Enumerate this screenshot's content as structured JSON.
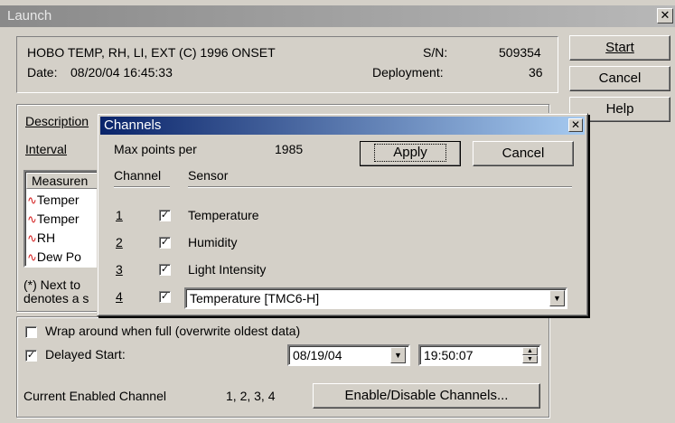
{
  "window": {
    "title": "Launch"
  },
  "info": {
    "device": "HOBO TEMP, RH, LI, EXT (C) 1996 ONSET",
    "date_label": "Date:",
    "date_value": "08/20/04  16:45:33",
    "sn_label": "S/N:",
    "sn_value": "509354",
    "deployment_label": "Deployment:",
    "deployment_value": "36"
  },
  "buttons": {
    "start": "Start",
    "cancel": "Cancel",
    "help": "Help"
  },
  "description": {
    "label": "Description",
    "interval_label": "Interval",
    "measurements_header": "Measuren",
    "measurements": [
      "Temper",
      "Temper",
      "RH",
      "Dew Po"
    ],
    "note_line1": "(*) Next to",
    "note_line2": "denotes a s"
  },
  "channels_dialog": {
    "title": "Channels",
    "max_points_label": "Max points per",
    "max_points_value": "1985",
    "apply_label": "Apply",
    "cancel_label": "Cancel",
    "channel_header": "Channel",
    "sensor_header": "Sensor",
    "rows": [
      {
        "channel": "1",
        "checked": true,
        "sensor": "Temperature"
      },
      {
        "channel": "2",
        "checked": true,
        "sensor": "Humidity"
      },
      {
        "channel": "3",
        "checked": true,
        "sensor": "Light Intensity"
      },
      {
        "channel": "4",
        "checked": true,
        "sensor": "Temperature [TMC6-H]"
      }
    ]
  },
  "options": {
    "wrap_label": "Wrap around when full (overwrite oldest data)",
    "wrap_checked": false,
    "delayed_label": "Delayed Start:",
    "delayed_checked": true,
    "delayed_date": "08/19/04",
    "delayed_time": "19:50:07",
    "enabled_label": "Current Enabled Channel",
    "enabled_value": "1, 2, 3, 4",
    "enable_button": "Enable/Disable Channels..."
  }
}
